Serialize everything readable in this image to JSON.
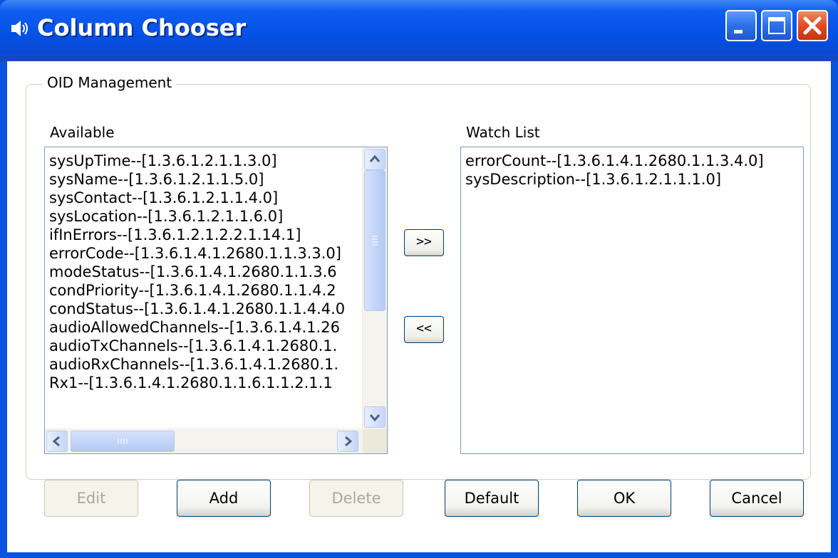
{
  "window": {
    "title": "Column Chooser"
  },
  "group": {
    "label": "OID Management"
  },
  "available": {
    "label": "Available",
    "items": [
      "sysUpTime--[1.3.6.1.2.1.1.3.0]",
      "sysName--[1.3.6.1.2.1.1.5.0]",
      "sysContact--[1.3.6.1.2.1.1.4.0]",
      "sysLocation--[1.3.6.1.2.1.1.6.0]",
      "ifInErrors--[1.3.6.1.2.1.2.2.1.14.1]",
      "errorCode--[1.3.6.1.4.1.2680.1.1.3.3.0]",
      "modeStatus--[1.3.6.1.4.1.2680.1.1.3.6",
      "condPriority--[1.3.6.1.4.1.2680.1.1.4.2",
      "condStatus--[1.3.6.1.4.1.2680.1.1.4.4.0",
      "audioAllowedChannels--[1.3.6.1.4.1.26",
      "audioTxChannels--[1.3.6.1.4.1.2680.1.",
      "audioRxChannels--[1.3.6.1.4.1.2680.1.",
      "Rx1--[1.3.6.1.4.1.2680.1.1.6.1.1.2.1.1"
    ]
  },
  "watch_list": {
    "label": "Watch List",
    "items": [
      "errorCount--[1.3.6.1.4.1.2680.1.1.3.4.0]",
      "sysDescription--[1.3.6.1.2.1.1.1.0]"
    ]
  },
  "move": {
    "add_label": ">>",
    "remove_label": "<<"
  },
  "buttons": {
    "edit": "Edit",
    "add": "Add",
    "delete": "Delete",
    "default": "Default",
    "ok": "OK",
    "cancel": "Cancel"
  },
  "colors": {
    "titlebar": "#0452e6",
    "close_button": "#e04b23",
    "list_border": "#7f9db9"
  }
}
